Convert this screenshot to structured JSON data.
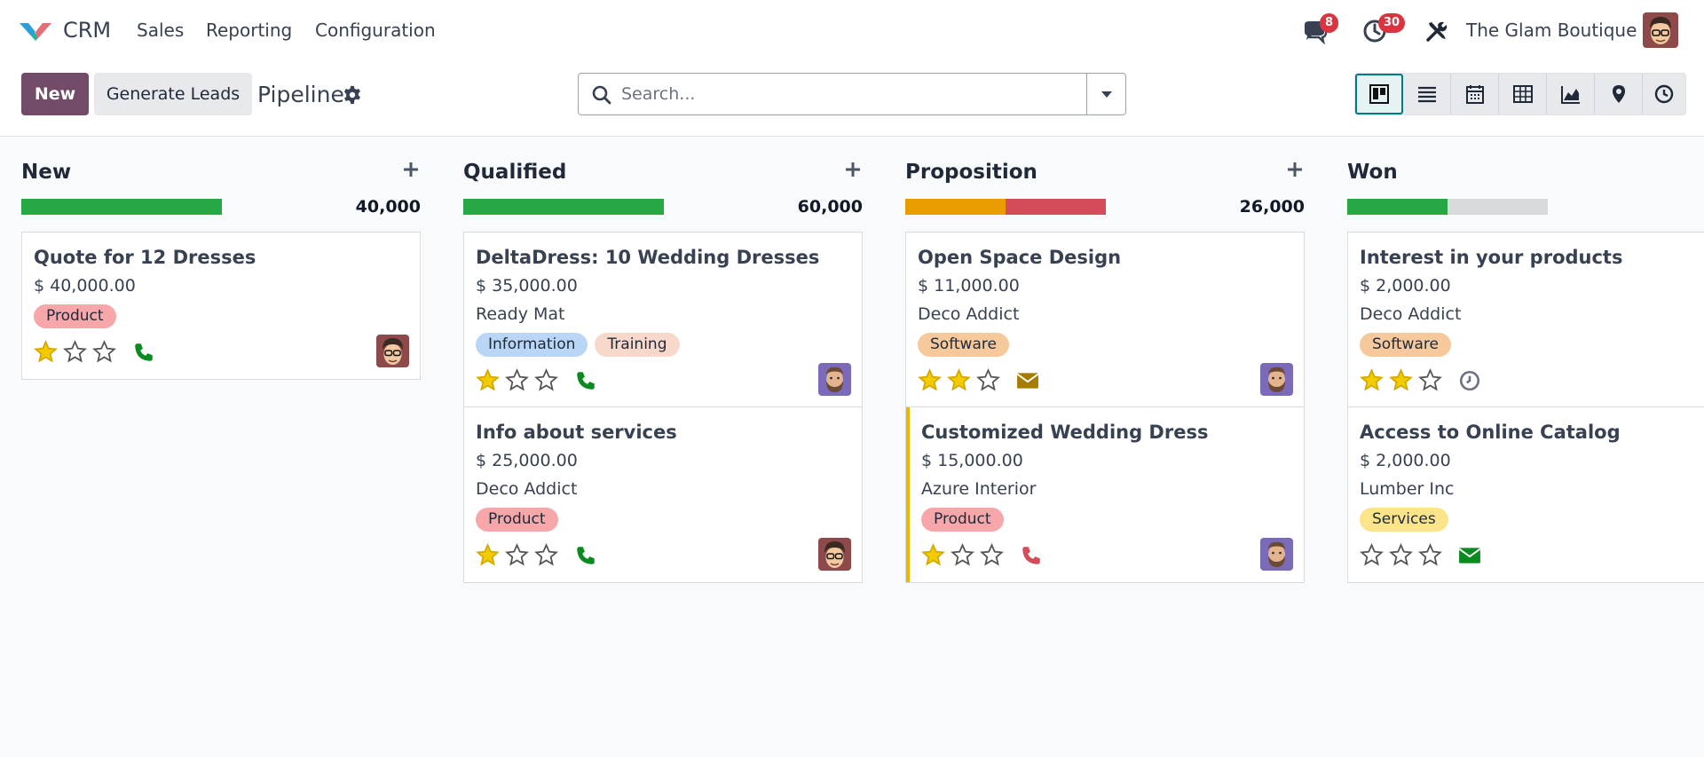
{
  "app": {
    "name": "CRM"
  },
  "menu": [
    "Sales",
    "Reporting",
    "Configuration"
  ],
  "nav": {
    "messages_count": "8",
    "activities_count": "30",
    "company": "The Glam Boutique"
  },
  "controls": {
    "new_label": "New",
    "generate_label": "Generate Leads",
    "page_title": "Pipeline",
    "search_placeholder": "Search..."
  },
  "views": [
    "kanban",
    "list",
    "calendar",
    "pivot",
    "graph",
    "map",
    "activity"
  ],
  "colors": {
    "brand": "#714b67",
    "green": "#28a745",
    "orange": "#e99d00",
    "red": "#d44c59",
    "star": "#f3cc00"
  },
  "columns": [
    {
      "title": "New",
      "total": "40,000",
      "progress": [
        {
          "color": "#28a745",
          "fraction": 1.0
        }
      ],
      "cards": [
        {
          "title": "Quote for 12 Dresses",
          "amount": "$ 40,000.00",
          "company": "",
          "tags": [
            {
              "label": "Product",
              "color": "#f7a7a9"
            }
          ],
          "stars": 1,
          "activity": "phone",
          "activity_color": "#0a8a1f",
          "avatar": "glasses"
        }
      ]
    },
    {
      "title": "Qualified",
      "total": "60,000",
      "progress": [
        {
          "color": "#28a745",
          "fraction": 1.0
        }
      ],
      "cards": [
        {
          "title": "DeltaDress: 10 Wedding Dresses",
          "amount": "$ 35,000.00",
          "company": "Ready Mat",
          "tags": [
            {
              "label": "Information",
              "color": "#b9d6f6"
            },
            {
              "label": "Training",
              "color": "#f9d8cc"
            }
          ],
          "stars": 1,
          "activity": "phone",
          "activity_color": "#0a8a1f",
          "avatar": "beard"
        },
        {
          "title": "Info about services",
          "amount": "$ 25,000.00",
          "company": "Deco Addict",
          "tags": [
            {
              "label": "Product",
              "color": "#f7a7a9"
            }
          ],
          "stars": 1,
          "activity": "phone",
          "activity_color": "#0a8a1f",
          "avatar": "glasses"
        }
      ]
    },
    {
      "title": "Proposition",
      "total": "26,000",
      "progress": [
        {
          "color": "#e99d00",
          "fraction": 0.5
        },
        {
          "color": "#d44c59",
          "fraction": 0.5
        }
      ],
      "cards": [
        {
          "title": "Open Space Design",
          "amount": "$ 11,000.00",
          "company": "Deco Addict",
          "tags": [
            {
              "label": "Software",
              "color": "#f6c99d"
            }
          ],
          "stars": 2,
          "activity": "mail",
          "activity_color": "#a67c00",
          "avatar": "beard"
        },
        {
          "title": "Customized Wedding Dress",
          "amount": "$ 15,000.00",
          "company": "Azure Interior",
          "tags": [
            {
              "label": "Product",
              "color": "#f7a7a9"
            }
          ],
          "stars": 1,
          "activity": "phone",
          "activity_color": "#d44c59",
          "avatar": "beard"
        }
      ]
    },
    {
      "title": "Won",
      "total": "",
      "progress": [
        {
          "color": "#28a745",
          "fraction": 0.5
        },
        {
          "color": "#d8dadd",
          "fraction": 0.5
        }
      ],
      "cards": [
        {
          "title": "Interest in your products",
          "amount": "$ 2,000.00",
          "company": "Deco Addict",
          "tags": [
            {
              "label": "Software",
              "color": "#f6c99d"
            }
          ],
          "stars": 2,
          "activity": "clock",
          "activity_color": "#6b7280",
          "avatar": ""
        },
        {
          "title": "Access to Online Catalog",
          "amount": "$ 2,000.00",
          "company": "Lumber Inc",
          "tags": [
            {
              "label": "Services",
              "color": "#fbe48a"
            }
          ],
          "stars": 0,
          "activity": "mail",
          "activity_color": "#0a8a1f",
          "avatar": ""
        }
      ]
    }
  ]
}
